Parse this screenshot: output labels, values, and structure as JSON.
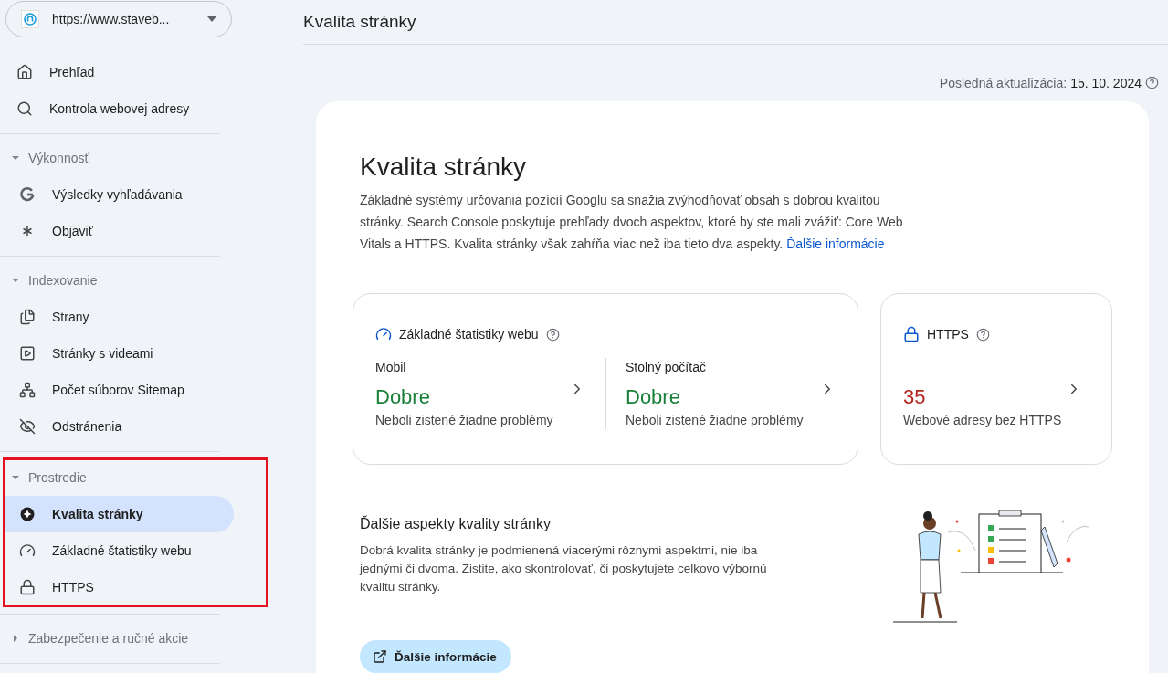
{
  "site_selector": {
    "value": "https://www.staveb..."
  },
  "sidebar": {
    "items": [
      {
        "label": "Prehľad",
        "selected": false
      },
      {
        "label": "Kontrola webovej adresy",
        "selected": false
      }
    ],
    "sections": [
      {
        "title": "Výkonnosť",
        "expanded": true,
        "highlighted": false,
        "items": [
          {
            "label": "Výsledky vyhľadávania",
            "selected": false
          },
          {
            "label": "Objaviť",
            "selected": false
          }
        ]
      },
      {
        "title": "Indexovanie",
        "expanded": true,
        "highlighted": false,
        "items": [
          {
            "label": "Strany",
            "selected": false
          },
          {
            "label": "Stránky s videami",
            "selected": false
          },
          {
            "label": "Počet súborov Sitemap",
            "selected": false
          },
          {
            "label": "Odstránenia",
            "selected": false
          }
        ]
      },
      {
        "title": "Prostredie",
        "expanded": true,
        "highlighted": true,
        "items": [
          {
            "label": "Kvalita stránky",
            "selected": true
          },
          {
            "label": "Základné štatistiky webu",
            "selected": false
          },
          {
            "label": "HTTPS",
            "selected": false
          }
        ]
      },
      {
        "title": "Zabezpečenie a ručné akcie",
        "expanded": false,
        "highlighted": false
      }
    ]
  },
  "header": {
    "title": "Kvalita stránky"
  },
  "last_update": {
    "label": "Posledná aktualizácia:",
    "value": "15. 10. 2024"
  },
  "intro": {
    "title": "Kvalita stránky",
    "text": "Základné systémy určovania pozícií Googlu sa snažia zvýhodňovať obsah s dobrou kvalitou stránky. Search Console poskytuje prehľady dvoch aspektov, ktoré by ste mali zvážiť: Core Web Vitals a HTTPS. Kvalita stránky však zahŕňa viac než iba tieto dva aspekty.",
    "link": "Ďalšie informácie"
  },
  "core_web_vitals": {
    "title": "Základné štatistiky webu",
    "columns": [
      {
        "label": "Mobil",
        "status": "Dobre",
        "kind": "good",
        "detail": "Neboli zistené žiadne problémy"
      },
      {
        "label": "Stolný počítač",
        "status": "Dobre",
        "kind": "good",
        "detail": "Neboli zistené žiadne problémy"
      }
    ]
  },
  "https_card": {
    "title": "HTTPS",
    "count": "35",
    "kind": "bad",
    "detail": "Webové adresy bez HTTPS"
  },
  "aspects": {
    "title": "Ďalšie aspekty kvality stránky",
    "text": "Dobrá kvalita stránky je podmienená viacerými rôznymi aspektmi, nie iba jednými či dvoma. Zistite, ako skontrolovať, či poskytujete celkovo výbornú kvalitu stránky.",
    "button": "Ďalšie informácie"
  }
}
